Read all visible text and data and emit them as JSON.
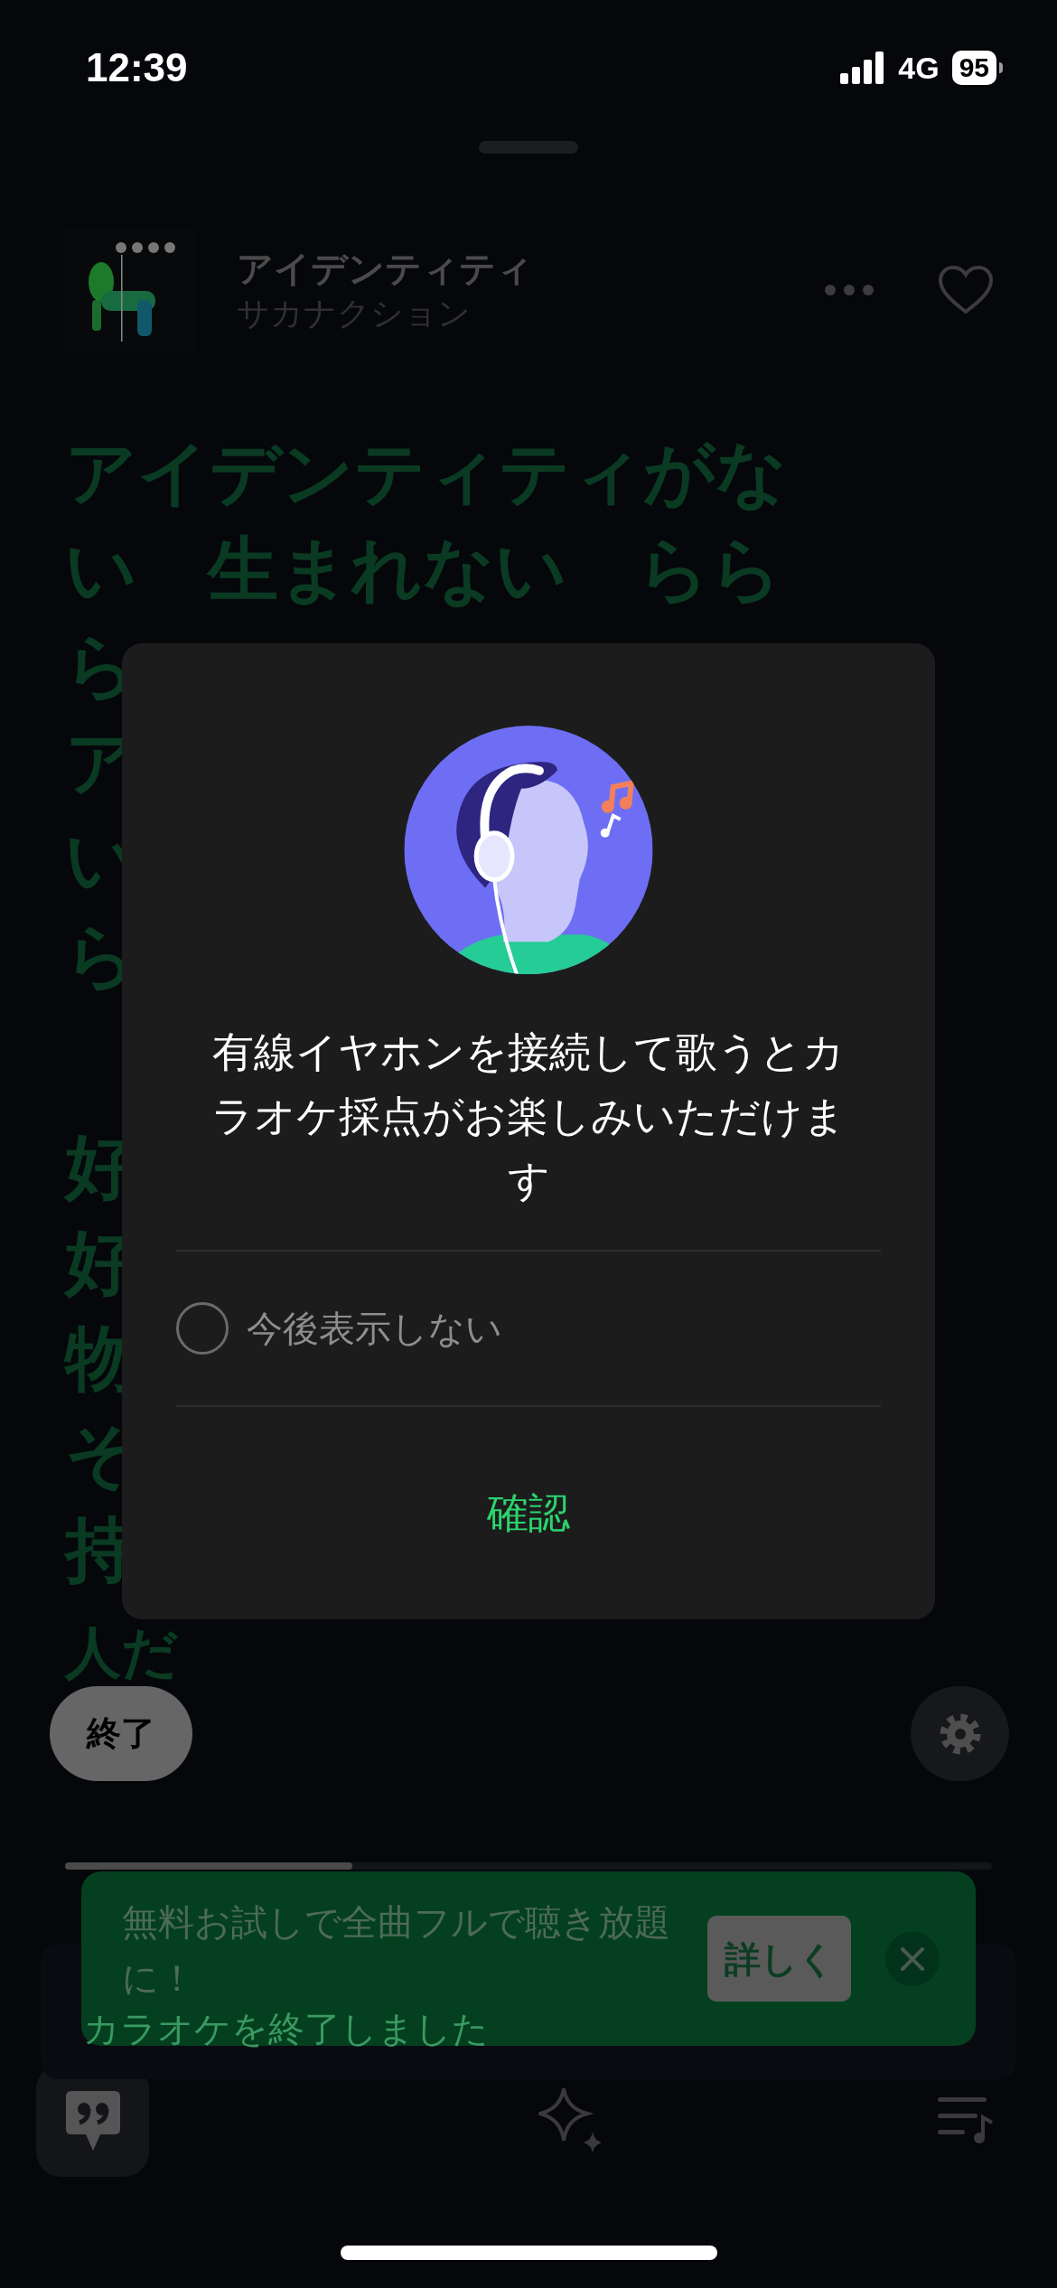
{
  "status_bar": {
    "time": "12:39",
    "network": "4G",
    "battery": "95"
  },
  "now_playing": {
    "title": "アイデンティティ",
    "artist": "サカナクション",
    "liked": false
  },
  "lyrics": [
    {
      "lines": [
        "アイデンティティがな",
        "い　生まれない　らら",
        "ら",
        "ア",
        "い",
        "ら"
      ]
    },
    {
      "lines": [
        "好",
        "好",
        "物",
        "そ",
        "持",
        "人だ"
      ]
    }
  ],
  "end_button": "終了",
  "progress": {
    "level": 0.31
  },
  "toast": {
    "text": "カラオケを終了しました"
  },
  "banner": {
    "text": "無料お試しで全曲フルで聴き放題に！",
    "button": "詳しく"
  },
  "dialog": {
    "message": "有線イヤホンを接続して歌うとカラオケ採点がお楽しみいただけます",
    "checkbox": {
      "label": "今後表示しない",
      "checked": false
    },
    "confirm": "確認"
  }
}
